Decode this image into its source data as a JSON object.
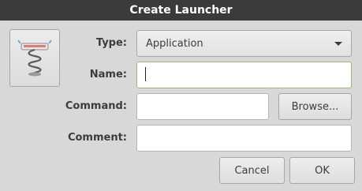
{
  "window": {
    "title": "Create Launcher"
  },
  "icon": {
    "name": "spring-launcher-icon"
  },
  "form": {
    "type_label": "Type:",
    "type_value": "Application",
    "name_label": "Name:",
    "name_value": "",
    "command_label": "Command:",
    "command_value": "",
    "browse_label": "Browse...",
    "comment_label": "Comment:",
    "comment_value": ""
  },
  "actions": {
    "cancel_label": "Cancel",
    "ok_label": "OK"
  },
  "colors": {
    "titlebar": "#3b3b3b",
    "dialog_bg": "#d8d8d8",
    "focus_border": "#9ab87c"
  }
}
